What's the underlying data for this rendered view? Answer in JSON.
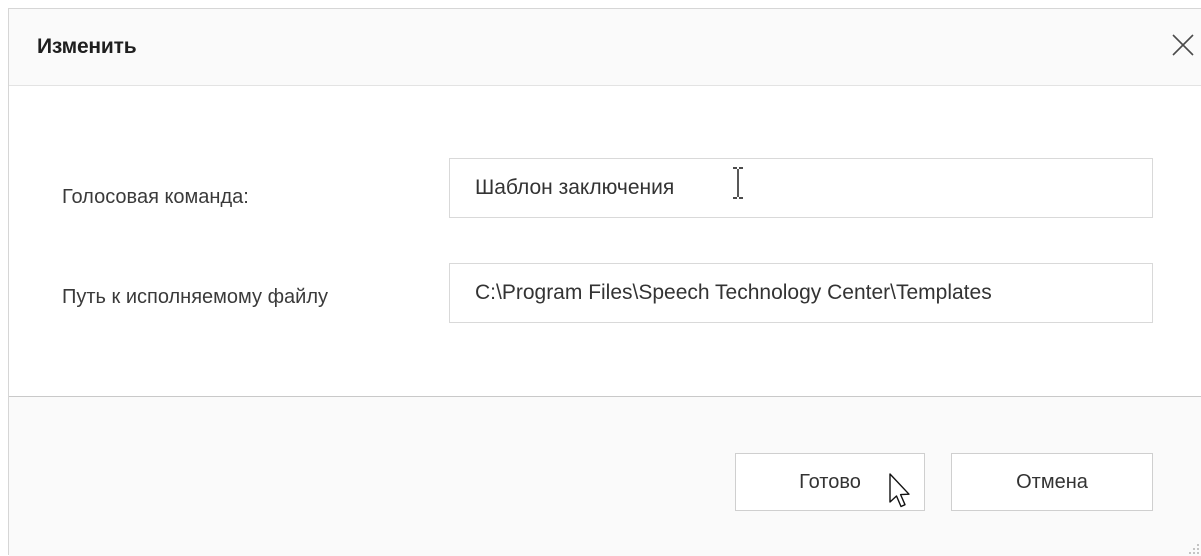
{
  "dialog": {
    "title": "Изменить",
    "close_icon": "close-icon"
  },
  "form": {
    "voice_command_label": "Голосовая команда:",
    "voice_command_value": "Шаблон заключения",
    "exe_path_label": "Путь к исполняемому файлу",
    "exe_path_value": "C:\\Program Files\\Speech Technology Center\\Templates"
  },
  "footer": {
    "ok_label": "Готово",
    "cancel_label": "Отмена"
  },
  "colors": {
    "title_bar_bg": "#fafafa",
    "content_bg": "#ffffff",
    "border": "#d9d9d9",
    "text": "#333333"
  }
}
